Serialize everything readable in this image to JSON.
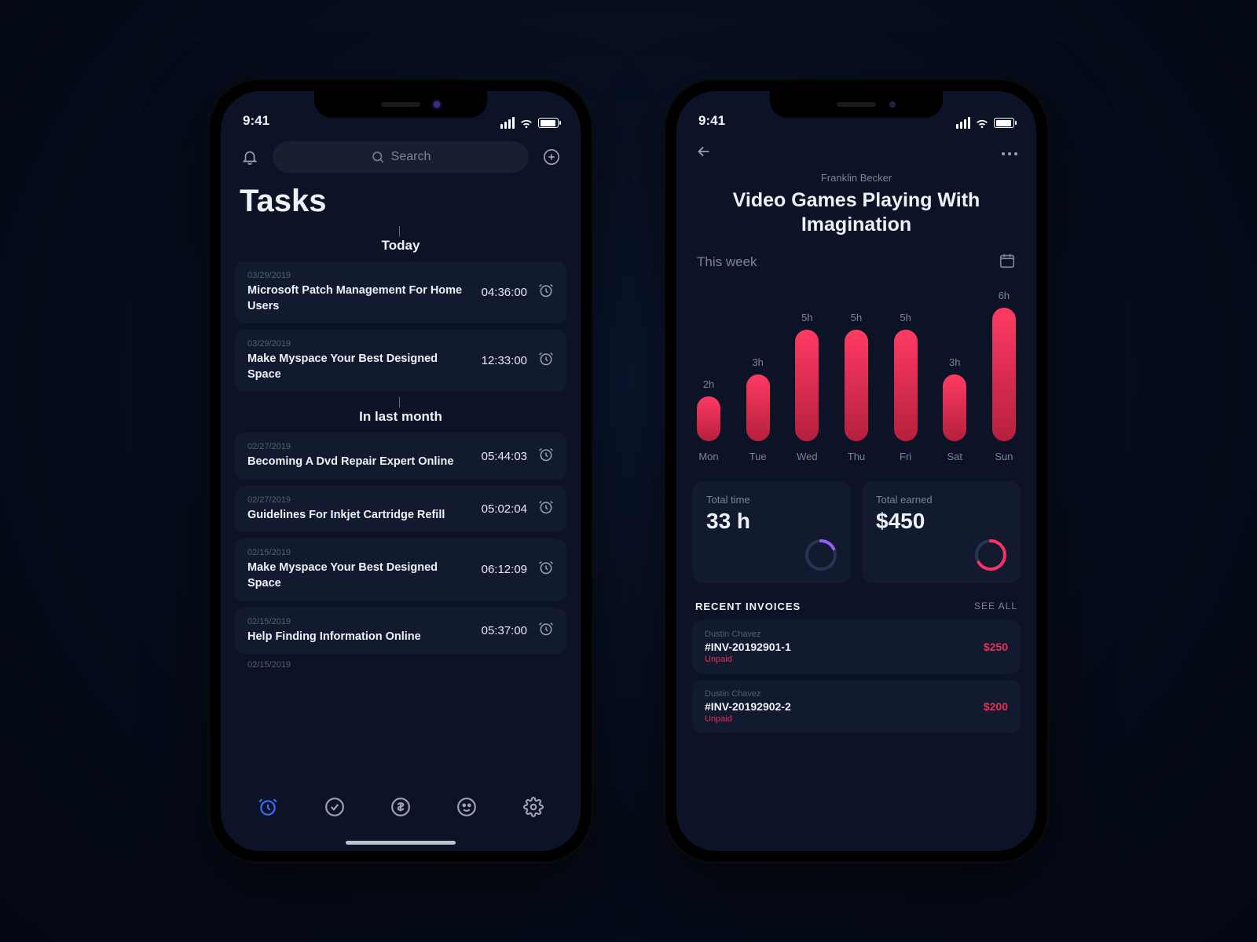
{
  "status_time": "9:41",
  "screen1": {
    "search_placeholder": "Search",
    "page_title": "Tasks",
    "sections": [
      {
        "label": "Today",
        "tasks": [
          {
            "date": "03/29/2019",
            "title": "Microsoft Patch Management For Home Users",
            "time": "04:36:00"
          },
          {
            "date": "03/29/2019",
            "title": "Make Myspace Your Best Designed Space",
            "time": "12:33:00"
          }
        ]
      },
      {
        "label": "In last month",
        "tasks": [
          {
            "date": "02/27/2019",
            "title": "Becoming A Dvd Repair Expert Online",
            "time": "05:44:03"
          },
          {
            "date": "02/27/2019",
            "title": "Guidelines For Inkjet Cartridge Refill",
            "time": "05:02:04"
          },
          {
            "date": "02/15/2019",
            "title": "Make Myspace Your Best Designed Space",
            "time": "06:12:09"
          },
          {
            "date": "02/15/2019",
            "title": "Help Finding Information Online",
            "time": "05:37:00"
          }
        ]
      }
    ],
    "next_date_stub": "02/15/2019"
  },
  "screen2": {
    "author": "Franklin Becker",
    "title": "Video Games Playing With Imagination",
    "range_label": "This week",
    "stats": {
      "total_time_label": "Total time",
      "total_time_value": "33 h",
      "total_earned_label": "Total earned",
      "total_earned_value": "$450"
    },
    "invoices_header": "RECENT INVOICES",
    "see_all": "SEE ALL",
    "invoices": [
      {
        "name": "Dustin Chavez",
        "number": "#INV-20192901-1",
        "status": "Unpaid",
        "amount": "$250"
      },
      {
        "name": "Dustin Chavez",
        "number": "#INV-20192902-2",
        "status": "Unpaid",
        "amount": "$200"
      }
    ]
  },
  "chart_data": {
    "type": "bar",
    "title": "This week",
    "categories": [
      "Mon",
      "Tue",
      "Wed",
      "Thu",
      "Fri",
      "Sat",
      "Sun"
    ],
    "values": [
      2,
      3,
      5,
      5,
      5,
      3,
      6
    ],
    "value_labels": [
      "2h",
      "3h",
      "5h",
      "5h",
      "5h",
      "3h",
      "6h"
    ],
    "ylabel": "hours",
    "ylim": [
      0,
      6
    ]
  }
}
